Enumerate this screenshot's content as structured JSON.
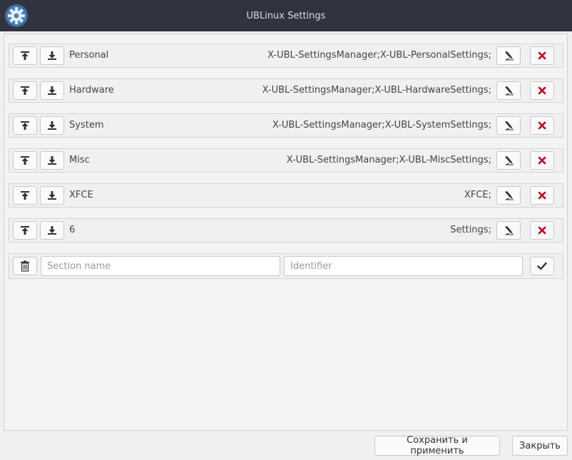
{
  "window": {
    "title": "UBLinux Settings"
  },
  "sections": [
    {
      "name": "Personal",
      "identifier": "X-UBL-SettingsManager;X-UBL-PersonalSettings;"
    },
    {
      "name": "Hardware",
      "identifier": "X-UBL-SettingsManager;X-UBL-HardwareSettings;"
    },
    {
      "name": "System",
      "identifier": "X-UBL-SettingsManager;X-UBL-SystemSettings;"
    },
    {
      "name": "Misc",
      "identifier": "X-UBL-SettingsManager;X-UBL-MiscSettings;"
    },
    {
      "name": "XFCE",
      "identifier": "XFCE;"
    },
    {
      "name": "6",
      "identifier": "Settings;"
    }
  ],
  "new_section": {
    "name_placeholder": "Section name",
    "name_value": "",
    "identifier_placeholder": "Identifier",
    "identifier_value": ""
  },
  "footer": {
    "save_label": "Сохранить и применить",
    "close_label": "Закрыть"
  },
  "colors": {
    "titlebar": "#2f343f",
    "delete_icon": "#d0021b",
    "icon": "#333333"
  },
  "icons": {
    "app": "gear-icon",
    "move_up": "move-top-icon",
    "move_down": "download-arrow-icon",
    "edit": "edit-clear-icon",
    "delete": "close-x-icon",
    "trash": "trash-icon",
    "confirm": "checkmark-icon"
  }
}
